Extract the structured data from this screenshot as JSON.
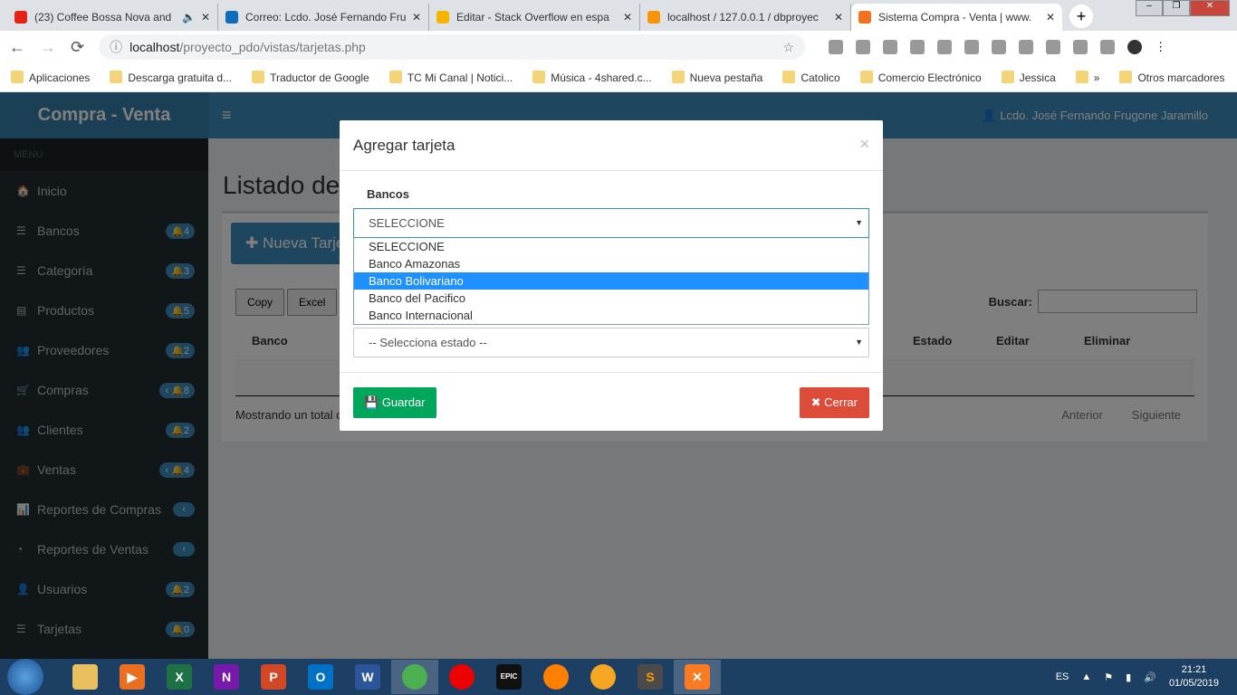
{
  "browser": {
    "tabs": [
      {
        "title": "(23) Coffee Bossa Nova and",
        "color": "#e62117",
        "audio": true
      },
      {
        "title": "Correo: Lcdo. José Fernando Fru",
        "color": "#0f6cbd"
      },
      {
        "title": "Editar - Stack Overflow en espa",
        "color": "#f4b400"
      },
      {
        "title": "localhost / 127.0.0.1 / dbproyec",
        "color": "#f89406"
      },
      {
        "title": "Sistema Compra - Venta | www.",
        "color": "#f37021",
        "active": true
      }
    ],
    "url_host": "localhost",
    "url_path": "/proyecto_pdo/vistas/tarjetas.php",
    "bookmarks": [
      "Aplicaciones",
      "Descarga gratuita d...",
      "Traductor de Google",
      "TC Mi Canal | Notici...",
      "Música - 4shared.c...",
      "Nueva pestaña",
      "Catolico",
      "Comercio Electrónico",
      "Jessica",
      "»",
      "Otros marcadores"
    ]
  },
  "header": {
    "logo": "Compra - Venta",
    "user": "Lcdo. José Fernando Frugone Jaramillo"
  },
  "sidebar": {
    "menu_label": "MENU",
    "items": [
      {
        "label": "Inicio",
        "icon": "home-icon"
      },
      {
        "label": "Bancos",
        "icon": "list-icon",
        "badge": "4"
      },
      {
        "label": "Categoría",
        "icon": "list-icon",
        "badge": "3"
      },
      {
        "label": "Productos",
        "icon": "table-icon",
        "badge": "5"
      },
      {
        "label": "Proveedores",
        "icon": "users-icon",
        "badge": "2"
      },
      {
        "label": "Compras",
        "icon": "cart-icon",
        "badge": "8",
        "expand": true
      },
      {
        "label": "Clientes",
        "icon": "users-icon",
        "badge": "2"
      },
      {
        "label": "Ventas",
        "icon": "briefcase-icon",
        "badge": "4",
        "expand": true
      },
      {
        "label": "Reportes de Compras",
        "icon": "bar-chart-icon",
        "expand_only": true
      },
      {
        "label": "Reportes de Ventas",
        "icon": "pie-chart-icon",
        "expand_only": true
      },
      {
        "label": "Usuarios",
        "icon": "user-icon",
        "badge": "2"
      },
      {
        "label": "Tarjetas",
        "icon": "list-icon",
        "badge": "0"
      }
    ]
  },
  "main": {
    "title": "Listado de",
    "new_button": "Nueva Tarje",
    "export_buttons": [
      "Copy",
      "Excel"
    ],
    "search_label": "Buscar:",
    "columns": [
      "Banco",
      "Estado",
      "Editar",
      "Eliminar"
    ],
    "info": "Mostrando un total d",
    "pager": [
      "Anterior",
      "Siguiente"
    ]
  },
  "modal": {
    "title": "Agregar tarjeta",
    "close": "×",
    "bank_label": "Bancos",
    "bank_selected": "SELECCIONE",
    "bank_options": [
      "SELECCIONE",
      "Banco Amazonas",
      "Banco Bolivariano",
      "Banco del Pacifico",
      "Banco Internacional"
    ],
    "bank_highlighted": "Banco Bolivariano",
    "estado_selected": "-- Selecciona estado --",
    "save": "Guardar",
    "cancel": "Cerrar"
  },
  "taskbar": {
    "lang": "ES",
    "time": "21:21",
    "date": "01/05/2019"
  }
}
